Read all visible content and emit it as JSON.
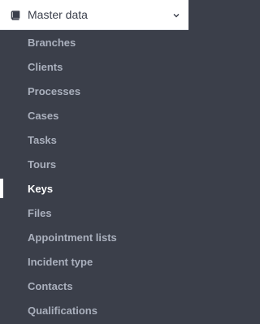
{
  "header": {
    "label": "Master data",
    "icon": "book-icon",
    "chevron_icon": "chevron-down-icon"
  },
  "items": [
    {
      "label": "Branches",
      "active": false
    },
    {
      "label": "Clients",
      "active": false
    },
    {
      "label": "Processes",
      "active": false
    },
    {
      "label": "Cases",
      "active": false
    },
    {
      "label": "Tasks",
      "active": false
    },
    {
      "label": "Tours",
      "active": false
    },
    {
      "label": "Keys",
      "active": true
    },
    {
      "label": "Files",
      "active": false
    },
    {
      "label": "Appointment lists",
      "active": false
    },
    {
      "label": "Incident type",
      "active": false
    },
    {
      "label": "Contacts",
      "active": false
    },
    {
      "label": "Qualifications",
      "active": false
    }
  ],
  "colors": {
    "background": "#3b3f4a",
    "header_background": "#ffffff",
    "item_text": "#aab0bd",
    "active_text": "#ffffff",
    "active_indicator": "#ffffff"
  }
}
